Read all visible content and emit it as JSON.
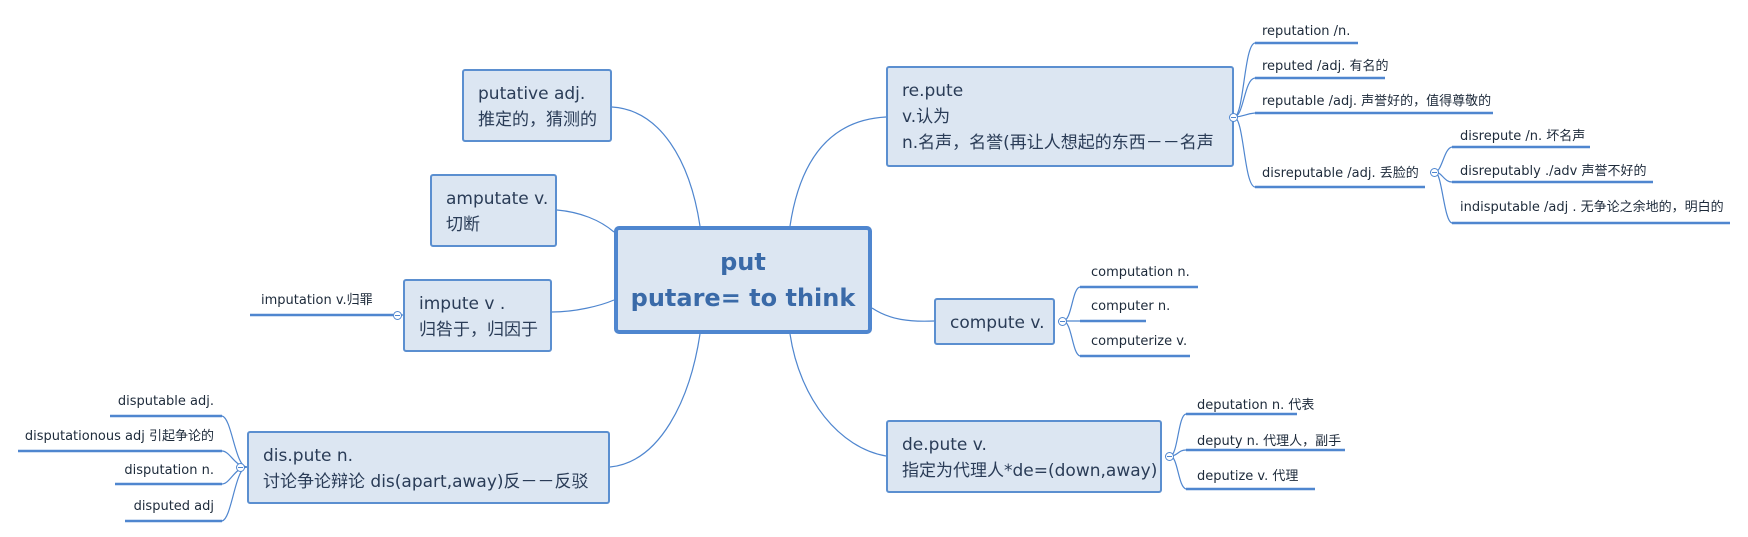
{
  "central": {
    "line1": "put",
    "line2": "putare= to think"
  },
  "topics": {
    "putative": {
      "line1": "putative adj.",
      "line2": "推定的，猜测的"
    },
    "amputate": {
      "line1": "amputate v.",
      "line2": "切断"
    },
    "impute": {
      "line1": "impute v .",
      "line2": "归咎于，归因于"
    },
    "dispute": {
      "line1": "dis.pute n.",
      "line2": "讨论争论辩论    dis(apart,away)反－－反驳"
    },
    "repute": {
      "line1": "re.pute",
      "line2": "v.认为",
      "line3": "n.名声，名誉(再让人想起的东西－－名声"
    },
    "compute": {
      "line1": "compute v."
    },
    "depute": {
      "line1": "de.pute v.",
      "line2": "指定为代理人*de=(down,away)"
    }
  },
  "subtopics": {
    "impute": [
      "imputation v.归罪"
    ],
    "dispute": [
      "disputable adj.",
      "disputationous adj 引起争论的",
      "disputation n.",
      "disputed adj"
    ],
    "repute": [
      "reputation /n.",
      "reputed /adj. 有名的",
      "reputable /adj. 声誉好的，值得尊敬的",
      "disreputable /adj. 丢脸的"
    ],
    "disreputable": [
      "disrepute /n. 坏名声",
      "disreputably ./adv 声誉不好的",
      "indisputable /adj . 无争论之余地的，明白的"
    ],
    "compute": [
      "computation n.",
      "computer n.",
      "computerize v."
    ],
    "depute": [
      "deputation n. 代表",
      "deputy n. 代理人，副手",
      "deputize v. 代理"
    ]
  },
  "colors": {
    "line": "#4f86cf",
    "fill": "#dce6f2",
    "text": "#2a3c57",
    "central_text": "#3a6aa8"
  }
}
